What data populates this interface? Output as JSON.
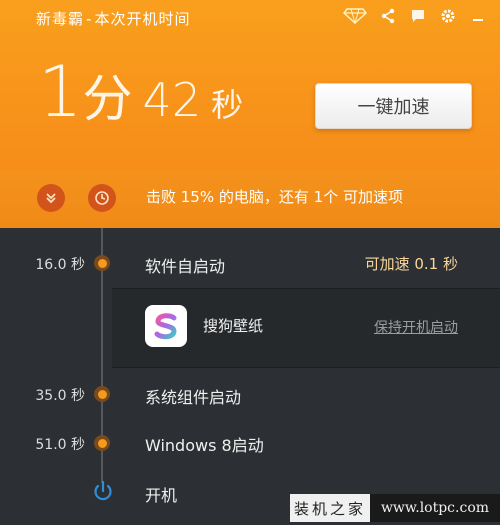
{
  "window": {
    "title_app": "新毒霸",
    "title_sep": "-",
    "title_page": "本次开机时间",
    "icons": [
      "gem-icon",
      "share-icon",
      "feedback-icon",
      "settings-icon",
      "minimize-icon"
    ]
  },
  "boot_time": {
    "minutes": "1",
    "minutes_unit": "分",
    "seconds": "42",
    "seconds_unit": "秒"
  },
  "speed_button": {
    "label": "一键加速"
  },
  "status": {
    "text": "击败 15% 的电脑，还有 1个 可加速项"
  },
  "timeline": {
    "items": [
      {
        "time": "16.0 秒",
        "label": "软件自启动",
        "badge": "可加速 0.1 秒"
      },
      {
        "time": "35.0 秒",
        "label": "系统组件启动"
      },
      {
        "time": "51.0 秒",
        "label": "Windows  8启动"
      },
      {
        "time": "",
        "label": "开机"
      }
    ],
    "startup_app": {
      "name": "搜狗壁纸",
      "action": "保持开机启动"
    }
  },
  "watermark": {
    "left": "装机之家",
    "right": "www.lotpc.com"
  },
  "colors": {
    "accent": "#f7941d",
    "dark_bg": "#2c2f33",
    "dot": "#f49a1c",
    "power": "#2f8fd6"
  }
}
